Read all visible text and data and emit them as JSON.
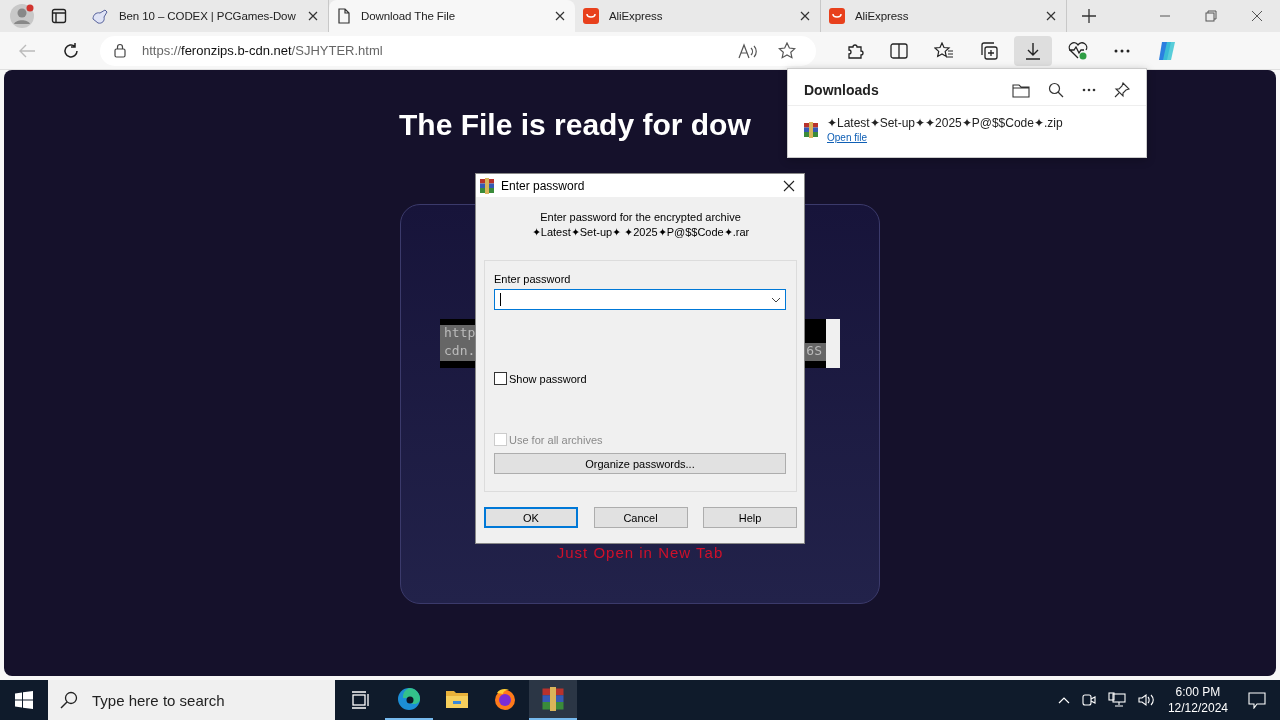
{
  "browser": {
    "tabs": [
      {
        "kind": "controller",
        "title": "Ben 10 – CODEX | PCGames-Dow",
        "selected": false
      },
      {
        "kind": "page",
        "title": "Download The File",
        "selected": true
      },
      {
        "kind": "aliexpress",
        "title": "AliExpress",
        "selected": false
      },
      {
        "kind": "aliexpress",
        "title": "AliExpress",
        "selected": false
      }
    ],
    "address": {
      "scheme": "https://",
      "host": "feronzips.b-cdn.net",
      "path": "/SJHYTER.html"
    },
    "downloads_panel": {
      "title": "Downloads",
      "items": [
        {
          "file": "✦Latest✦Set-up✦✦2025✦P@$$Code✦.zip",
          "action": "Open file"
        }
      ]
    }
  },
  "page": {
    "heading": "The File is ready for dow",
    "textarea": {
      "lines": [
        {
          "start": "http"
        },
        {
          "start": "cdn.",
          "end": "6S"
        }
      ]
    },
    "notice": "Just Open in New Tab"
  },
  "dialog": {
    "title": "Enter password",
    "message": [
      "Enter password for the encrypted archive",
      "✦Latest✦Set-up✦ ✦2025✦P@$$Code✦.rar"
    ],
    "field_label": "Enter password",
    "checkboxes": [
      {
        "label": "Show password",
        "checked": false,
        "disabled": false
      },
      {
        "label": "Use for all archives",
        "checked": false,
        "disabled": true
      }
    ],
    "organize_button": "Organize passwords...",
    "buttons": [
      {
        "label": "OK",
        "default": true
      },
      {
        "label": "Cancel",
        "default": false
      },
      {
        "label": "Help",
        "default": false
      }
    ]
  },
  "taskbar": {
    "search_placeholder": "Type here to search",
    "apps": [
      {
        "kind": "edge",
        "running": true,
        "selected": false
      },
      {
        "kind": "explorer",
        "running": false,
        "selected": false
      },
      {
        "kind": "firefox",
        "running": false,
        "selected": false
      },
      {
        "kind": "winrar",
        "running": true,
        "selected": true
      }
    ],
    "time": "6:00 PM",
    "date": "12/12/2024"
  }
}
